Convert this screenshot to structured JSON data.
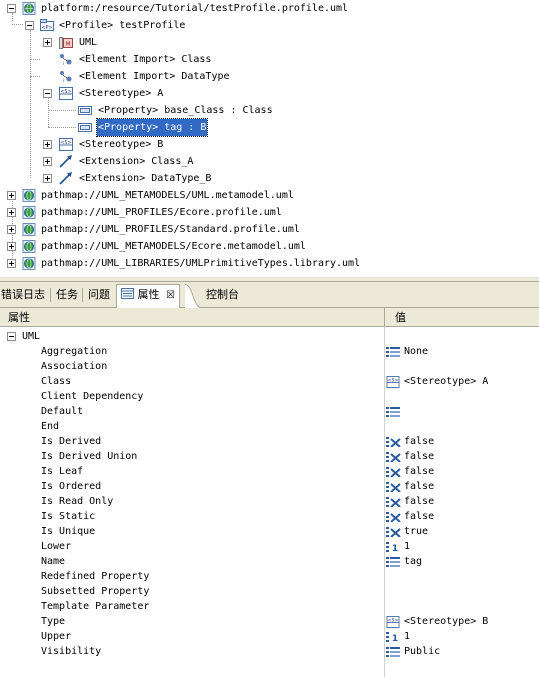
{
  "tree": {
    "rows": [
      {
        "label": "platform:/resource/Tutorial/testProfile.profile.uml",
        "icon": "resource-globe-icon",
        "exp": "minus"
      },
      {
        "label": "<Profile> testProfile",
        "icon": "profile-icon",
        "exp": "minus"
      },
      {
        "label": "UML",
        "icon": "uml-package-icon",
        "exp": "plus"
      },
      {
        "label": "<Element Import> Class",
        "icon": "element-import-icon",
        "exp": "none"
      },
      {
        "label": "<Element Import> DataType",
        "icon": "element-import-icon",
        "exp": "none"
      },
      {
        "label": "<Stereotype> A",
        "icon": "stereotype-icon",
        "exp": "minus"
      },
      {
        "label": "<Property> base_Class : Class",
        "icon": "property-icon",
        "exp": "none"
      },
      {
        "label": "<Property> tag : B",
        "icon": "property-icon",
        "exp": "none",
        "selected": true
      },
      {
        "label": "<Stereotype> B",
        "icon": "stereotype-icon",
        "exp": "plus"
      },
      {
        "label": "<Extension> Class_A",
        "icon": "extension-arrow-icon",
        "exp": "plus"
      },
      {
        "label": "<Extension> DataType_B",
        "icon": "extension-arrow-icon",
        "exp": "plus"
      },
      {
        "label": "pathmap://UML_METAMODELS/UML.metamodel.uml",
        "icon": "resource-globe-icon",
        "exp": "plus"
      },
      {
        "label": "pathmap://UML_PROFILES/Ecore.profile.uml",
        "icon": "resource-globe-icon",
        "exp": "plus"
      },
      {
        "label": "pathmap://UML_PROFILES/Standard.profile.uml",
        "icon": "resource-globe-icon",
        "exp": "plus"
      },
      {
        "label": "pathmap://UML_METAMODELS/Ecore.metamodel.uml",
        "icon": "resource-globe-icon",
        "exp": "plus"
      },
      {
        "label": "pathmap://UML_LIBRARIES/UMLPrimitiveTypes.library.uml",
        "icon": "resource-globe-icon",
        "exp": "plus"
      }
    ]
  },
  "tabs": {
    "error_log": "错误日志",
    "tasks": "任务",
    "problems": "问题",
    "properties": "属性",
    "close": "☒",
    "console": "控制台"
  },
  "props": {
    "col_property": "属性",
    "col_value": "值",
    "group": "UML",
    "rows": [
      {
        "name": "Aggregation",
        "value": "None",
        "icon": "enum-icon"
      },
      {
        "name": "Association",
        "value": "",
        "icon": ""
      },
      {
        "name": "Class",
        "value": "<Stereotype> A",
        "icon": "stereotype-icon"
      },
      {
        "name": "Client Dependency",
        "value": "",
        "icon": ""
      },
      {
        "name": "Default",
        "value": "",
        "icon": "enum-icon"
      },
      {
        "name": "End",
        "value": "",
        "icon": ""
      },
      {
        "name": "Is Derived",
        "value": "false",
        "icon": "boolean-icon"
      },
      {
        "name": "Is Derived Union",
        "value": "false",
        "icon": "boolean-icon"
      },
      {
        "name": "Is Leaf",
        "value": "false",
        "icon": "boolean-icon"
      },
      {
        "name": "Is Ordered",
        "value": "false",
        "icon": "boolean-icon"
      },
      {
        "name": "Is Read Only",
        "value": "false",
        "icon": "boolean-icon"
      },
      {
        "name": "Is Static",
        "value": "false",
        "icon": "boolean-icon"
      },
      {
        "name": "Is Unique",
        "value": "true",
        "icon": "boolean-icon"
      },
      {
        "name": "Lower",
        "value": "1",
        "icon": "integer-icon"
      },
      {
        "name": "Name",
        "value": "tag",
        "icon": "enum-icon"
      },
      {
        "name": "Redefined Property",
        "value": "",
        "icon": ""
      },
      {
        "name": "Subsetted Property",
        "value": "",
        "icon": ""
      },
      {
        "name": "Template Parameter",
        "value": "",
        "icon": ""
      },
      {
        "name": "Type",
        "value": "<Stereotype> B",
        "icon": "stereotype-icon"
      },
      {
        "name": "Upper",
        "value": "1",
        "icon": "integer-icon"
      },
      {
        "name": "Visibility",
        "value": "Public",
        "icon": "enum-icon"
      }
    ]
  }
}
